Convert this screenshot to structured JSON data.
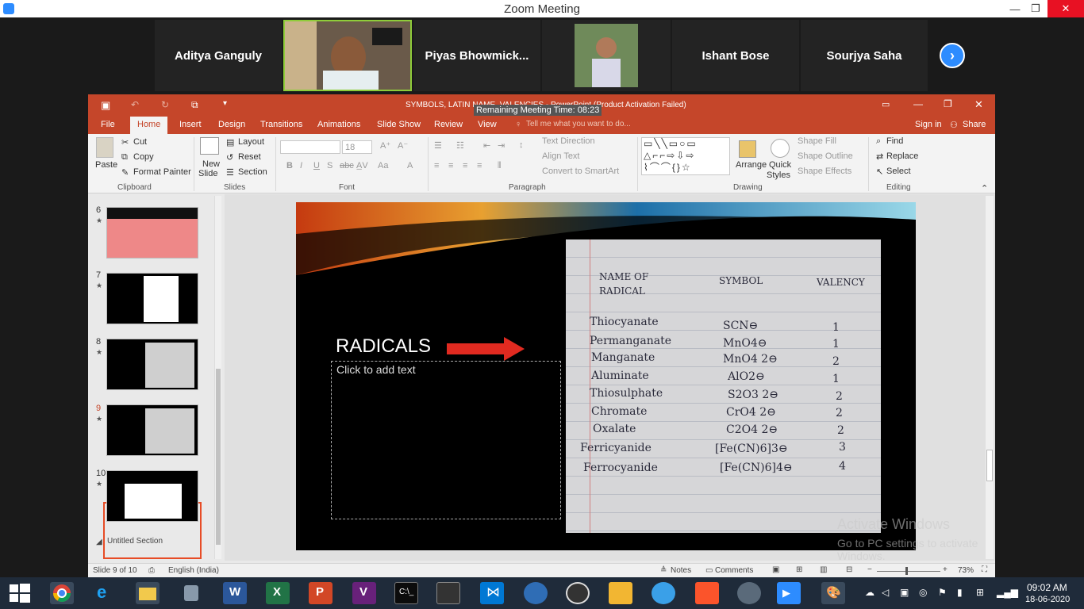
{
  "zoom": {
    "title": "Zoom Meeting",
    "minimize": "—",
    "maximize": "❐",
    "close": "✕",
    "remaining": "Remaining Meeting Time: 08:23"
  },
  "participants": [
    {
      "name": "Aditya Ganguly"
    },
    {
      "name": "Piyas  Bhowmick..."
    },
    {
      "name": "Ishant Bose"
    },
    {
      "name": "Sourjya Saha"
    }
  ],
  "gallery_next": "›",
  "ppt": {
    "window_title": "SYMBOLS, LATIN NAME, VALENCIES - PowerPoint (Product Activation Failed)",
    "tabs": [
      "File",
      "Home",
      "Insert",
      "Design",
      "Transitions",
      "Animations",
      "Slide Show",
      "Review",
      "View"
    ],
    "tell_me": "Tell me what you want to do...",
    "sign_in": "Sign in",
    "share": "Share",
    "clipboard": {
      "paste": "Paste",
      "cut": "Cut",
      "copy": "Copy",
      "format_painter": "Format Painter",
      "group": "Clipboard"
    },
    "slides_group": {
      "new_slide": "New",
      "new_slide2": "Slide",
      "layout": "Layout",
      "reset": "Reset",
      "section": "Section",
      "group": "Slides"
    },
    "font": {
      "size": "18",
      "bold": "B",
      "italic": "I",
      "underline": "U",
      "strike": "S",
      "abc": "abc",
      "group": "Font"
    },
    "paragraph": {
      "text_direction": "Text Direction",
      "align_text": "Align Text",
      "smartart": "Convert to SmartArt",
      "group": "Paragraph"
    },
    "drawing": {
      "arrange": "Arrange",
      "quick_styles": "Quick",
      "quick_styles2": "Styles",
      "shape_fill": "Shape Fill",
      "shape_outline": "Shape Outline",
      "shape_effects": "Shape Effects",
      "group": "Drawing"
    },
    "editing": {
      "find": "Find",
      "replace": "Replace",
      "select": "Select",
      "group": "Editing"
    },
    "thumbnails": [
      {
        "num": "6"
      },
      {
        "num": "7"
      },
      {
        "num": "8"
      },
      {
        "num": "9"
      },
      {
        "num": "10"
      }
    ],
    "section_label": "Untitled Section",
    "slide": {
      "title": "RADICALS",
      "placeholder": "Click to add text",
      "table_headers": [
        "NAME OF",
        "RADICAL",
        "SYMBOL",
        "VALENCY"
      ],
      "rows": [
        {
          "name": "Thiocyanate",
          "symbol": "SCN⊖",
          "valency": "1"
        },
        {
          "name": "Permanganate",
          "symbol": "MnO4⊖",
          "valency": "1"
        },
        {
          "name": "Manganate",
          "symbol": "MnO4 2⊖",
          "valency": "2"
        },
        {
          "name": "Aluminate",
          "symbol": "AlO2⊖",
          "valency": "1"
        },
        {
          "name": "Thiosulphate",
          "symbol": "S2O3 2⊖",
          "valency": "2"
        },
        {
          "name": "Chromate",
          "symbol": "CrO4 2⊖",
          "valency": "2"
        },
        {
          "name": "Oxalate",
          "symbol": "C2O4 2⊖",
          "valency": "2"
        },
        {
          "name": "Ferricyanide",
          "symbol": "[Fe(CN)6]3⊖",
          "valency": "3"
        },
        {
          "name": "Ferrocyanide",
          "symbol": "[Fe(CN)6]4⊖",
          "valency": "4"
        }
      ]
    },
    "watermark": {
      "line1": "Activate Windows",
      "line2": "Go to PC settings to activate Windows."
    },
    "status": {
      "slide_info": "Slide 9 of 10",
      "language": "English (India)",
      "notes": "Notes",
      "comments": "Comments",
      "zoom": "73%"
    }
  },
  "taskbar": {
    "time": "09:02 AM",
    "date": "18-06-2020"
  }
}
